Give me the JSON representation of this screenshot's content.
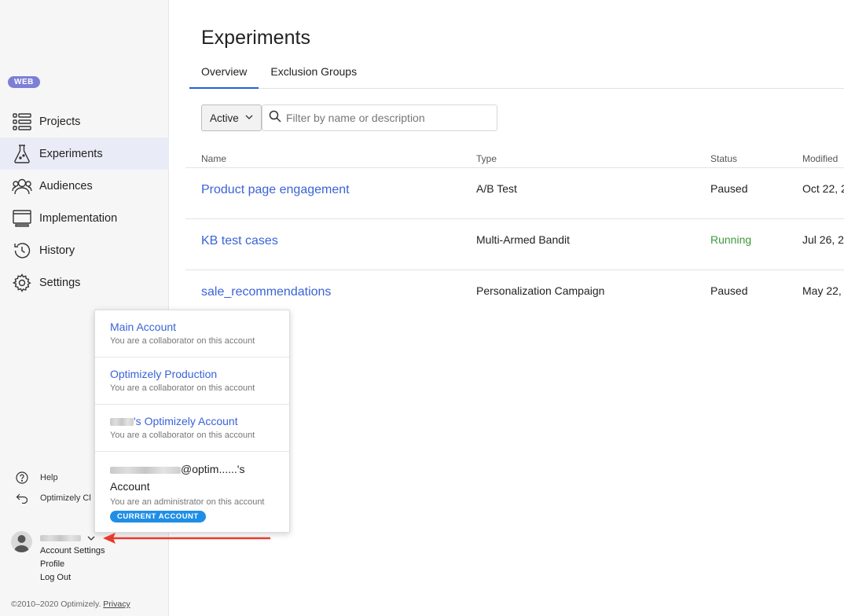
{
  "sidebar": {
    "badge": "WEB",
    "nav": [
      {
        "label": "Projects",
        "icon": "projects-icon"
      },
      {
        "label": "Experiments",
        "icon": "flask-icon",
        "active": true
      },
      {
        "label": "Audiences",
        "icon": "audiences-icon"
      },
      {
        "label": "Implementation",
        "icon": "implementation-icon"
      },
      {
        "label": "History",
        "icon": "history-icon"
      },
      {
        "label": "Settings",
        "icon": "gear-icon"
      }
    ],
    "help_label": "Help",
    "classic_label": "Optimizely Cl",
    "user_menu": {
      "account_settings": "Account Settings",
      "profile": "Profile",
      "log_out": "Log Out"
    },
    "footer_text": "©2010–2020 Optimizely.",
    "footer_link": "Privacy"
  },
  "main": {
    "title": "Experiments",
    "tabs": [
      {
        "label": "Overview",
        "active": true
      },
      {
        "label": "Exclusion Groups",
        "active": false
      }
    ],
    "filter": {
      "value": "Active"
    },
    "search": {
      "placeholder": "Filter by name or description",
      "value": ""
    },
    "columns": {
      "name": "Name",
      "type": "Type",
      "status": "Status",
      "modified": "Modified"
    },
    "rows": [
      {
        "name": "Product page engagement",
        "type": "A/B Test",
        "status": "Paused",
        "modified": "Oct 22, 2"
      },
      {
        "name": "KB test cases",
        "type": "Multi-Armed Bandit",
        "status": "Running",
        "modified": "Jul 26, 2"
      },
      {
        "name": "sale_recommendations",
        "type": "Personalization Campaign",
        "status": "Paused",
        "modified": "May 22,"
      }
    ]
  },
  "dropdown": {
    "accounts": [
      {
        "name": "Main Account",
        "role": "You are a collaborator on this account"
      },
      {
        "name": "Optimizely Production",
        "role": "You are a collaborator on this account"
      },
      {
        "name": "'s Optimizely Account",
        "role": "You are a collaborator on this account"
      },
      {
        "name_line1": "@optim......'s",
        "name_line2": "Account",
        "role": "You are an administrator on this account",
        "badge": "CURRENT ACCOUNT"
      }
    ]
  },
  "colors": {
    "link": "#3a63d6",
    "running": "#3c9a3c",
    "active_tab": "#1f63d6",
    "badge": "#1f8ee6",
    "arrow": "#e8392b"
  }
}
